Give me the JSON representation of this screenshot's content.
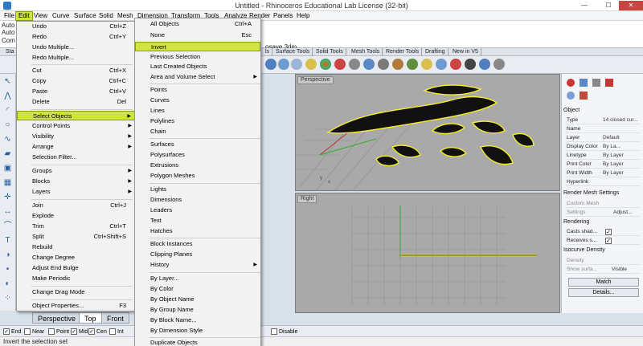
{
  "window": {
    "title": "Untitled - Rhinoceros Educational Lab License (32-bit)",
    "minimize": "—",
    "maximize": "☐",
    "close": "✕"
  },
  "menubar": [
    "File",
    "Edit",
    "View",
    "Curve",
    "Surface",
    "Solid",
    "Mesh",
    "Dimension",
    "Transform",
    "Tools",
    "Analyze",
    "Render",
    "Panels",
    "Help"
  ],
  "active_menu": "Edit",
  "command_area": {
    "lines": [
      "Auto",
      "Auto",
      "Com"
    ],
    "filename_fragment": "osave.3dm"
  },
  "toolbar_tabs": [
    "Sta",
    "ls",
    "Surface Tools",
    "Solid Tools",
    "Mesh Tools",
    "Render Tools",
    "Drafting",
    "New in V5"
  ],
  "edit_menu": [
    {
      "label": "Undo",
      "shortcut": "Ctrl+Z"
    },
    {
      "label": "Redo",
      "shortcut": "Ctrl+Y"
    },
    {
      "label": "Undo Multiple...",
      "shortcut": ""
    },
    {
      "label": "Redo Multiple...",
      "shortcut": ""
    },
    {
      "label": "Cut",
      "shortcut": "Ctrl+X"
    },
    {
      "label": "Copy",
      "shortcut": "Ctrl+C"
    },
    {
      "label": "Paste",
      "shortcut": "Ctrl+V"
    },
    {
      "label": "Delete",
      "shortcut": "Del"
    },
    {
      "label": "Select Objects",
      "shortcut": ""
    },
    {
      "label": "Control Points",
      "shortcut": ""
    },
    {
      "label": "Visibility",
      "shortcut": ""
    },
    {
      "label": "Arrange",
      "shortcut": ""
    },
    {
      "label": "Selection Filter...",
      "shortcut": ""
    },
    {
      "label": "Groups",
      "shortcut": ""
    },
    {
      "label": "Blocks",
      "shortcut": ""
    },
    {
      "label": "Layers",
      "shortcut": ""
    },
    {
      "label": "Join",
      "shortcut": "Ctrl+J"
    },
    {
      "label": "Explode",
      "shortcut": ""
    },
    {
      "label": "Trim",
      "shortcut": "Ctrl+T"
    },
    {
      "label": "Split",
      "shortcut": "Ctrl+Shift+S"
    },
    {
      "label": "Rebuild",
      "shortcut": ""
    },
    {
      "label": "Change Degree",
      "shortcut": ""
    },
    {
      "label": "Adjust End Bulge",
      "shortcut": ""
    },
    {
      "label": "Make Periodic",
      "shortcut": ""
    },
    {
      "label": "Change Drag Mode",
      "shortcut": ""
    },
    {
      "label": "Object Properties...",
      "shortcut": "F3"
    }
  ],
  "select_submenu": [
    {
      "label": "All Objects",
      "shortcut": "Ctrl+A"
    },
    {
      "label": "None",
      "shortcut": "Esc"
    },
    {
      "label": "Invert",
      "shortcut": ""
    },
    {
      "label": "Previous Selection",
      "shortcut": ""
    },
    {
      "label": "Last Created Objects",
      "shortcut": ""
    },
    {
      "label": "Area and Volume Select",
      "shortcut": ""
    },
    {
      "label": "Points",
      "shortcut": ""
    },
    {
      "label": "Curves",
      "shortcut": ""
    },
    {
      "label": "Lines",
      "shortcut": ""
    },
    {
      "label": "Polylines",
      "shortcut": ""
    },
    {
      "label": "Chain",
      "shortcut": ""
    },
    {
      "label": "Surfaces",
      "shortcut": ""
    },
    {
      "label": "Polysurfaces",
      "shortcut": ""
    },
    {
      "label": "Extrusions",
      "shortcut": ""
    },
    {
      "label": "Polygon Meshes",
      "shortcut": ""
    },
    {
      "label": "Lights",
      "shortcut": ""
    },
    {
      "label": "Dimensions",
      "shortcut": ""
    },
    {
      "label": "Leaders",
      "shortcut": ""
    },
    {
      "label": "Text",
      "shortcut": ""
    },
    {
      "label": "Hatches",
      "shortcut": ""
    },
    {
      "label": "Block Instances",
      "shortcut": ""
    },
    {
      "label": "Clipping Planes",
      "shortcut": ""
    },
    {
      "label": "History",
      "shortcut": ""
    },
    {
      "label": "By Layer...",
      "shortcut": ""
    },
    {
      "label": "By Color",
      "shortcut": ""
    },
    {
      "label": "By Object Name",
      "shortcut": ""
    },
    {
      "label": "By Group Name",
      "shortcut": ""
    },
    {
      "label": "By Block Name...",
      "shortcut": ""
    },
    {
      "label": "By Dimension Style",
      "shortcut": ""
    },
    {
      "label": "Duplicate Objects",
      "shortcut": ""
    }
  ],
  "viewports": {
    "top_label": "Perspective",
    "bottom_label": "Right"
  },
  "properties": {
    "section": "Object",
    "rows": [
      {
        "key": "Type",
        "value": "14 closed cur..."
      },
      {
        "key": "Name",
        "value": ""
      },
      {
        "key": "Layer",
        "value": "Default"
      },
      {
        "key": "Display Color",
        "value": "By La..."
      },
      {
        "key": "Linetype",
        "value": "By Layer"
      },
      {
        "key": "Print Color",
        "value": "By Layer"
      },
      {
        "key": "Print Width",
        "value": "By Layer"
      },
      {
        "key": "Hyperlink",
        "value": ""
      }
    ],
    "render_mesh": {
      "title": "Render Mesh Settings",
      "custom_mesh": "Custom Mesh",
      "settings": "Settings",
      "adjust": "Adjust..."
    },
    "rendering": {
      "title": "Rendering",
      "casts": "Casts shad...",
      "receives": "Receives s..."
    },
    "isocurve": {
      "title": "Isocurve Density",
      "density": "Density",
      "show_surface": "Show surfa...",
      "visible": "Visible"
    },
    "match_button": "Match",
    "details_button": "Details..."
  },
  "viewport_tabs": [
    "Perspective",
    "Top",
    "Front"
  ],
  "active_viewport_tab": "Top",
  "osnaps": [
    {
      "label": "End",
      "checked": true
    },
    {
      "label": "Near",
      "checked": false
    },
    {
      "label": "Point",
      "checked": false
    },
    {
      "label": "Mid",
      "checked": true
    },
    {
      "label": "Cen",
      "checked": true
    },
    {
      "label": "Int",
      "checked": false
    },
    {
      "label": "Disable",
      "checked": false
    }
  ],
  "status_text": "Invert the selection set",
  "colors": {
    "highlight": "#cfe342",
    "curve_yellow": "#f2ec2c",
    "viewport_gray": "#a9a9a9"
  }
}
